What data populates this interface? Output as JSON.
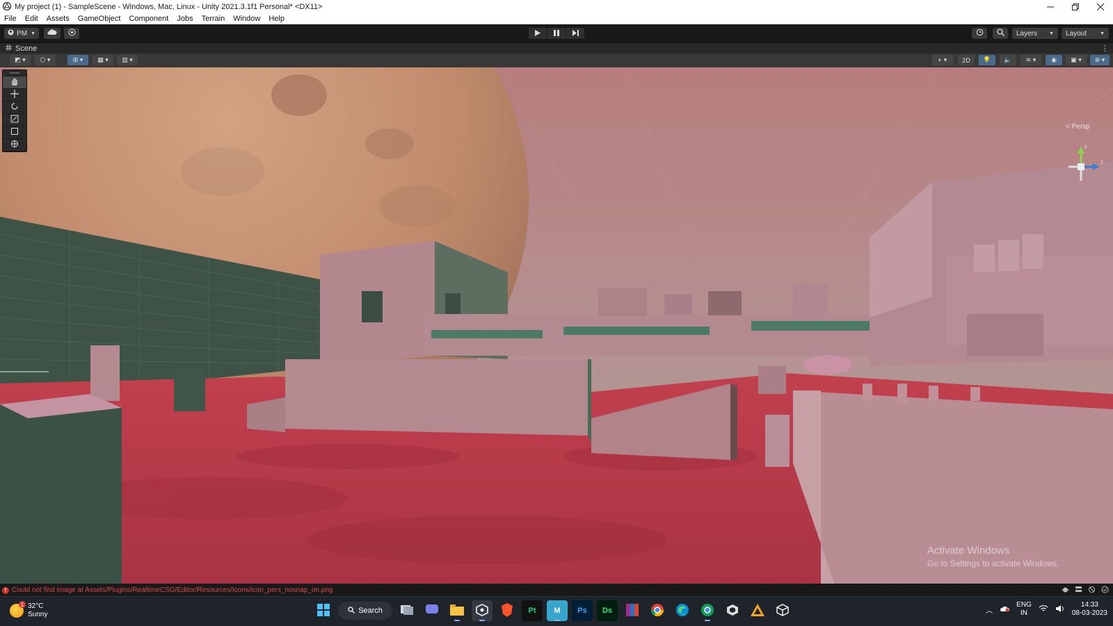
{
  "window": {
    "title": "My project (1) - SampleScene - Windows, Mac, Linux - Unity 2021.3.1f1 Personal* <DX11>"
  },
  "menu": {
    "items": [
      "File",
      "Edit",
      "Assets",
      "GameObject",
      "Component",
      "Jobs",
      "Terrain",
      "Window",
      "Help"
    ]
  },
  "toolbar": {
    "account_label": "PM",
    "layers_label": "Layers",
    "layout_label": "Layout"
  },
  "scene": {
    "tab_label": "Scene",
    "mode_2d_label": "2D",
    "persp_label": "< Persp",
    "gizmo_y": "y",
    "gizmo_z": "z"
  },
  "watermark": {
    "line1": "Activate Windows",
    "line2": "Go to Settings to activate Windows."
  },
  "status": {
    "error_message": "Could not find image at Assets/Plugins/RealtimeCSG/Editor/Resources/Icons/icon_pers_nosnap_on.png"
  },
  "taskbar": {
    "weather_temp": "32°C",
    "weather_desc": "Sunny",
    "weather_badge": "1",
    "search_label": "Search",
    "apps": [
      "windows-start",
      "search",
      "task-view",
      "teams",
      "file-explorer",
      "unity-hub",
      "brave",
      "pycharm",
      "maya",
      "photoshop",
      "dimension",
      "winrar",
      "chrome",
      "edge",
      "chrome-profile",
      "unity",
      "blender-like",
      "unity-3d"
    ],
    "lang_line1": "ENG",
    "lang_line2": "IN",
    "time": "14:33",
    "date": "08-03-2023"
  },
  "colors": {
    "sky": "#c08484",
    "ground": "#b83a4a",
    "planet": "#c98f6e",
    "structure": "#b48a90",
    "structure_dark": "#3f5a4e"
  }
}
